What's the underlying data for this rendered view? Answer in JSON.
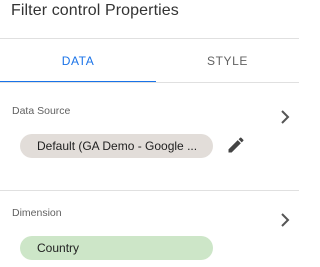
{
  "panel": {
    "title": "Filter control Properties"
  },
  "tabs": [
    {
      "label": "DATA",
      "active": true
    },
    {
      "label": "STYLE",
      "active": false
    }
  ],
  "data_source": {
    "label": "Data Source",
    "value": "Default (GA Demo - Google ..."
  },
  "dimension": {
    "label": "Dimension",
    "value": "Country"
  },
  "icons": {
    "edit": "pencil-icon",
    "expand": "chevron-right-icon"
  },
  "colors": {
    "accent": "#1a73e8",
    "data_source_chip": "#e2ddd9",
    "dimension_chip": "#cde6c8"
  }
}
